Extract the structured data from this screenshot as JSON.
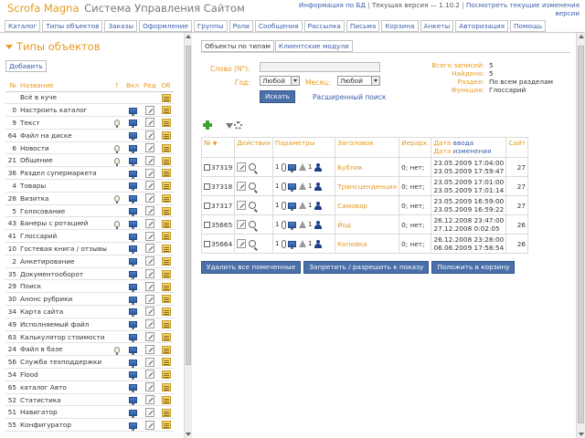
{
  "header": {
    "brand_main": "Scrofa Magna",
    "brand_sub": "Система Управления Сайтом",
    "info_link": "Информация по БД",
    "version": "Текущая версия — 1.10.2",
    "changes_link": "Посмотреть текущие изменения",
    "changes_link_2": "версии"
  },
  "nav": [
    {
      "label": "Каталог"
    },
    {
      "label": "Типы объектов"
    },
    {
      "label": "Заказы"
    },
    {
      "label": "Оформление"
    },
    {
      "label": "Группы"
    },
    {
      "label": "Роли"
    },
    {
      "label": "Сообщения"
    },
    {
      "label": "Рассылка"
    },
    {
      "label": "Письма"
    },
    {
      "label": "Корзина"
    },
    {
      "label": "Анкеты"
    },
    {
      "label": "Авторизация"
    },
    {
      "label": "Помощь"
    }
  ],
  "left": {
    "title": "Типы объектов",
    "add_label": "Добавить",
    "columns": {
      "num": "№",
      "name": "Название",
      "q": "?",
      "vkl": "Вкл",
      "red": "Ред",
      "ob": "Об"
    },
    "rows": [
      {
        "num": "",
        "name": "Всё в куче",
        "bulb": false,
        "monitor": false,
        "edit": false
      },
      {
        "num": "0",
        "name": "Настроить каталог",
        "bulb": false,
        "monitor": true,
        "edit": true
      },
      {
        "num": "9",
        "name": "Текст",
        "bulb": true,
        "monitor": true,
        "edit": true
      },
      {
        "num": "64",
        "name": "Файл на диске",
        "bulb": false,
        "monitor": true,
        "edit": true
      },
      {
        "num": "6",
        "name": "Новости",
        "bulb": true,
        "monitor": true,
        "edit": true
      },
      {
        "num": "21",
        "name": "Общение",
        "bulb": true,
        "monitor": true,
        "edit": true
      },
      {
        "num": "36",
        "name": "Раздел супермаркета",
        "bulb": false,
        "monitor": true,
        "edit": true
      },
      {
        "num": "4",
        "name": "Товары",
        "bulb": false,
        "monitor": true,
        "edit": true
      },
      {
        "num": "28",
        "name": "Визитка",
        "bulb": true,
        "monitor": true,
        "edit": true
      },
      {
        "num": "5",
        "name": "Голосование",
        "bulb": false,
        "monitor": true,
        "edit": true
      },
      {
        "num": "43",
        "name": "Банеры с ротацией",
        "bulb": true,
        "monitor": true,
        "edit": true
      },
      {
        "num": "41",
        "name": "Глоссарий",
        "bulb": false,
        "monitor": true,
        "edit": true
      },
      {
        "num": "10",
        "name": "Гостевая книга / отзывы",
        "bulb": false,
        "monitor": true,
        "edit": true
      },
      {
        "num": "2",
        "name": "Анкетирование",
        "bulb": false,
        "monitor": true,
        "edit": true
      },
      {
        "num": "35",
        "name": "Документооборот",
        "bulb": false,
        "monitor": true,
        "edit": true
      },
      {
        "num": "29",
        "name": "Поиск",
        "bulb": false,
        "monitor": true,
        "edit": true
      },
      {
        "num": "30",
        "name": "Анонс рубрики",
        "bulb": false,
        "monitor": true,
        "edit": true
      },
      {
        "num": "34",
        "name": "Карта сайта",
        "bulb": false,
        "monitor": true,
        "edit": true
      },
      {
        "num": "49",
        "name": "Исполняемый файл",
        "bulb": false,
        "monitor": true,
        "edit": true
      },
      {
        "num": "63",
        "name": "Калькулятор стоимости",
        "bulb": false,
        "monitor": true,
        "edit": true
      },
      {
        "num": "24",
        "name": "Файл в базе",
        "bulb": true,
        "monitor": true,
        "edit": true
      },
      {
        "num": "56",
        "name": "Служба техподдержки",
        "bulb": false,
        "monitor": true,
        "edit": true
      },
      {
        "num": "54",
        "name": "Flood",
        "bulb": false,
        "monitor": true,
        "edit": true
      },
      {
        "num": "65",
        "name": "каталог Авто",
        "bulb": false,
        "monitor": true,
        "edit": true
      },
      {
        "num": "52",
        "name": "Статистика",
        "bulb": false,
        "monitor": true,
        "edit": true
      },
      {
        "num": "51",
        "name": "Навигатор",
        "bulb": false,
        "monitor": true,
        "edit": true
      },
      {
        "num": "55",
        "name": "Конфигуратор",
        "bulb": false,
        "monitor": true,
        "edit": true
      }
    ]
  },
  "tabs": [
    {
      "label": "Объекты по типам"
    },
    {
      "label": "Клиентские модули"
    }
  ],
  "filter": {
    "word_label": "Слово (N°):",
    "word_value": "",
    "year_label": "Год:",
    "year_value": "Любой",
    "month_label": "Месяц:",
    "month_value": "Любой",
    "search_label": "Искать",
    "advanced_link": "Расширенный поиск"
  },
  "stats": {
    "total_label": "Всего записей:",
    "total_value": "5",
    "found_label": "Найдено:",
    "found_value": "5",
    "section_label": "Раздел:",
    "section_value": "По всем разделам",
    "function_label": "Функция:",
    "function_value": "Глоссарий"
  },
  "table": {
    "headers": {
      "num": "№",
      "actions": "Действия",
      "params": "Параметры",
      "title": "Заголовок",
      "hier": "Иерарх.",
      "date": "Дата",
      "date_in": "ввода",
      "date_change_1": "Дата",
      "date_change_2": "изменения",
      "site": "Сайт"
    },
    "rows": [
      {
        "id": "37319",
        "pcount": "1",
        "ucount": "1",
        "title": "Бублик",
        "hier": "0; нет;",
        "date_in": "23.05.2009 17:04:00",
        "date_mod": "23.05.2009 17:59:47",
        "site": "27"
      },
      {
        "id": "37318",
        "pcount": "1",
        "ucount": "1",
        "title": "Трансценденция",
        "hier": "0; нет;",
        "date_in": "23.05.2009 17:01:00",
        "date_mod": "23.05.2009 17:01:14",
        "site": "27"
      },
      {
        "id": "37317",
        "pcount": "1",
        "ucount": "1",
        "title": "Самовар",
        "hier": "0; нет;",
        "date_in": "23.05.2009 16:59:00",
        "date_mod": "23.05.2009 16:59:22",
        "site": "27"
      },
      {
        "id": "35665",
        "pcount": "1",
        "ucount": "1",
        "title": "Йод",
        "hier": "0; нет;",
        "date_in": "26.12.2008 23:47:00",
        "date_mod": "27.12.2008 0:02:05",
        "site": "26"
      },
      {
        "id": "35664",
        "pcount": "1",
        "ucount": "1",
        "title": "Копейка",
        "hier": "0; нет;",
        "date_in": "26.12.2008 23:28:00",
        "date_mod": "06.06.2009 17:58:54",
        "site": "26"
      }
    ]
  },
  "bottom_actions": {
    "delete_marked": "Удалить все помеченные",
    "toggle_show": "Запретить / разрешить к показу",
    "to_trash": "Положить в корзину"
  }
}
